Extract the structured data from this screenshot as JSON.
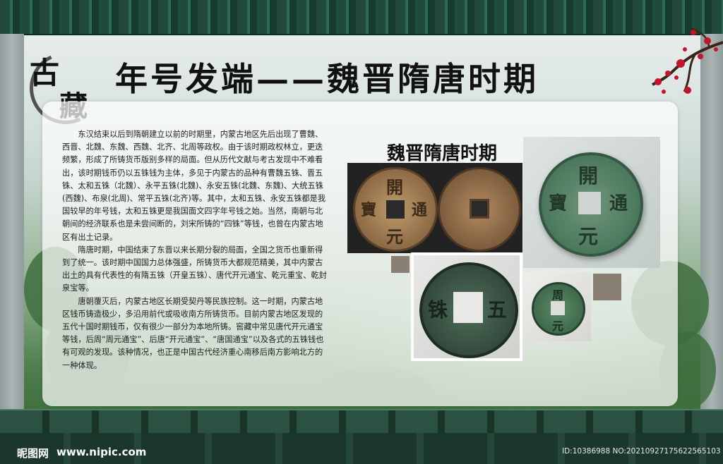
{
  "header": {
    "seal_char_1": "古",
    "seal_char_2": "藏",
    "title": "年号发端——魏晋隋唐时期"
  },
  "panel": {
    "era_label": "魏晋隋唐时期",
    "paragraphs": [
      "东汉结束以后到隋朝建立以前的时期里，内蒙古地区先后出现了曹魏、西晋、北魏、东魏、西魏、北齐、北周等政权。由于该时期政权林立，更迭频繁，形成了所铸货币版别多样的局面。但从历代文献与考古发现中不难看出，该时期钱币仍以五铢钱为主体，多见于内蒙古的品种有曹魏五铢、晋五铢、太和五铢（北魏）、永平五铢(北魏)、永安五铢(北魏、东魏)、大统五铢(西魏)、布泉(北周)、常平五铢(北齐)等。其中，太和五铢、永安五铢都是我国较早的年号钱，太和五铢更是我国面文四字年号钱之始。当然，南朝与北朝间的经济联系也是未尝间断的，刘宋所铸的“四铢”等钱，也曾在内蒙古地区有出土记录。",
      "隋唐时期，中国结束了东晋以来长期分裂的局面，全国之货币也重新得到了统一。该时期中国国力总体强盛，所铸货币大都规范精美，其中内蒙古出土的具有代表性的有隋五铢（开皇五铢）、唐代开元通宝、乾元重宝、乾封泉宝等。",
      "唐朝覆灭后，内蒙古地区长期受契丹等民族控制。这一时期，内蒙古地区钱币铸造极少，多沿用前代或吸收南方所铸货币。目前内蒙古地区发现的五代十国时期钱币，仅有很少一部分为本地所铸。窖藏中常见唐代开元通宝等钱，后周“周元通宝”、后唐“开元通宝”、“唐国通宝”以及各式的五铢钱也有可观的发现。该种情况，也正是中国古代经济重心南移后南方影响北方的一种体现。"
    ]
  },
  "coins": {
    "coin_1": [
      "開",
      "元",
      "通",
      "寶"
    ],
    "coin_3": [
      "開",
      "元",
      "通",
      "寶"
    ],
    "coin_4": [
      "五",
      "铢"
    ],
    "coin_5": [
      "周",
      "元"
    ]
  },
  "footer": {
    "logo": "昵图网",
    "url": "www.nipic.com",
    "id": "ID:10386988 NO:20210927175622565103"
  },
  "colors": {
    "frame_green": "#1f4a3c",
    "coin_bronze": "#b58a5c",
    "coin_patina": "#4f7a5a"
  }
}
